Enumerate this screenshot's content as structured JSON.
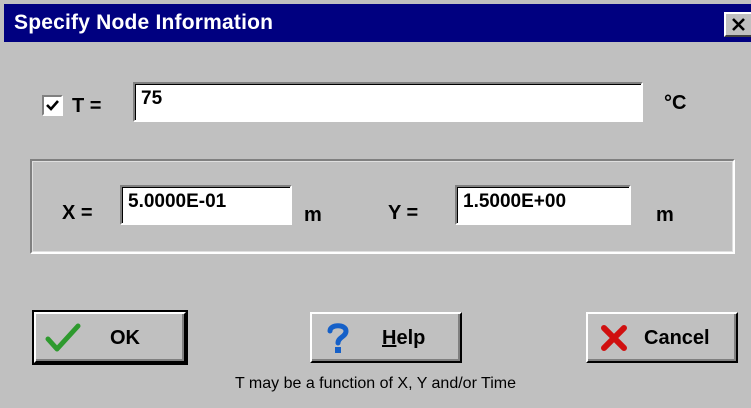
{
  "window": {
    "title": "Specify Node Information"
  },
  "temperature": {
    "checked": true,
    "label": "T =",
    "value": "75",
    "unit": "°C"
  },
  "coordinates": {
    "x_label": "X =",
    "x_value": "5.0000E-01",
    "x_unit": "m",
    "y_label": "Y =",
    "y_value": "1.5000E+00",
    "y_unit": "m"
  },
  "buttons": {
    "ok_label": "OK",
    "help_label": "Help",
    "help_mnemonic": "H",
    "help_rest": "elp",
    "cancel_label": "Cancel"
  },
  "hint_text": "T may be a function of X, Y and/or Time",
  "icons": {
    "ok": "checkmark-icon",
    "help": "question-mark-icon",
    "cancel": "x-cancel-icon",
    "close": "close-icon"
  },
  "colors": {
    "titlebar": "#000080",
    "face": "#c0c0c0",
    "ok_check": "#2e9a2e",
    "help_question": "#1560c8",
    "cancel_x": "#d01010"
  }
}
